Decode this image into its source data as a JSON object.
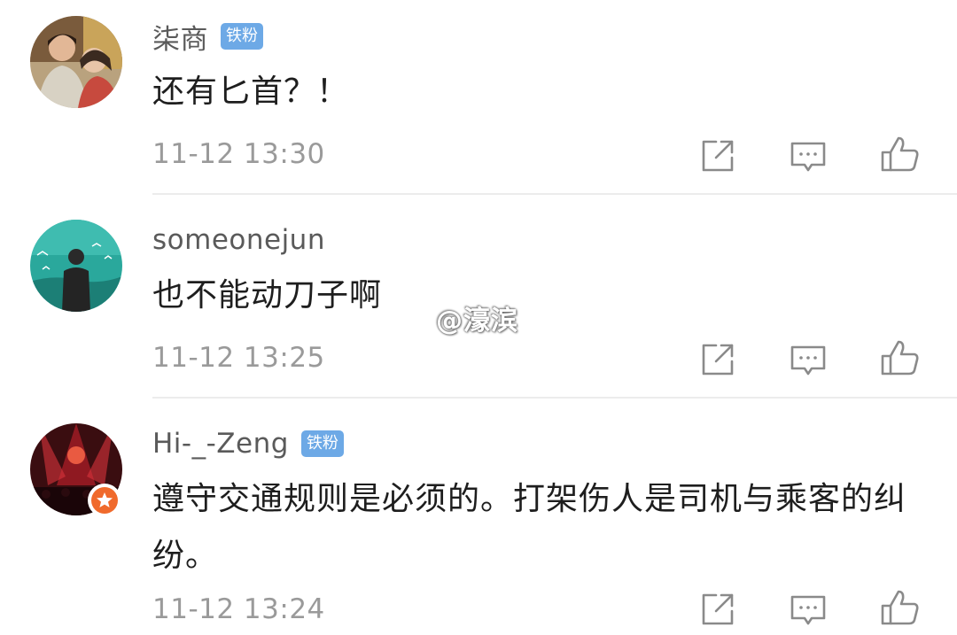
{
  "comments": [
    {
      "username": "柒商",
      "badge": "铁粉",
      "text": "还有匕首？！",
      "time": "11-12 13:30",
      "avatar_icon": "couple-photo-avatar"
    },
    {
      "username": "someonejun",
      "badge": "",
      "text": "也不能动刀子啊",
      "time": "11-12 13:25",
      "avatar_icon": "man-in-suit-avatar"
    },
    {
      "username": "Hi-_-Zeng",
      "badge": "铁粉",
      "text": "遵守交通规则是必须的。打架伤人是司机与乘客的纠纷。",
      "time": "11-12 13:24",
      "avatar_icon": "stage-lights-avatar"
    }
  ],
  "actions": {
    "share_icon": "share-icon",
    "reply_icon": "comment-icon",
    "like_icon": "thumbs-up-icon"
  },
  "watermark": "@濠滨",
  "colors": {
    "badge_bg": "#6da9e6",
    "username": "#5a5a5a",
    "timestamp": "#9a9a9a",
    "icon": "#8a8a8a",
    "verified_badge": "#f06a2c"
  }
}
